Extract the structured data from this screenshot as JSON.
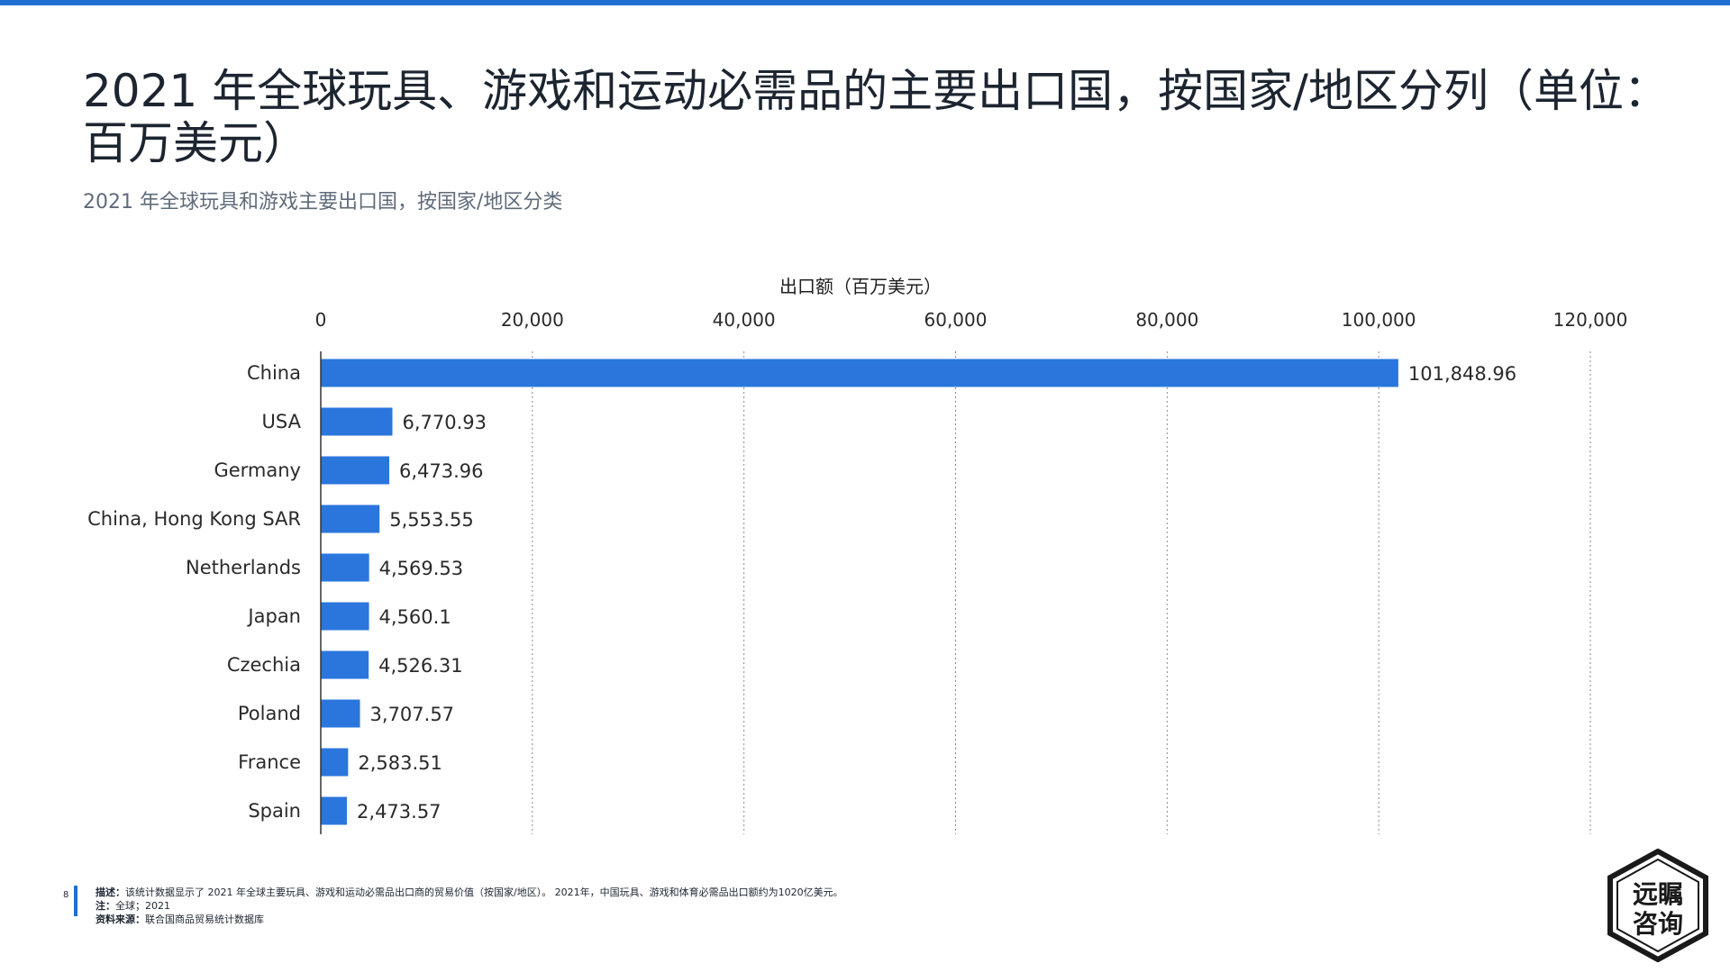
{
  "header": {
    "title": "2021 年全球玩具、游戏和运动必需品的主要出口国，按国家/地区分列（单位：百万美元）",
    "subtitle": "2021 年全球玩具和游戏主要出口国，按国家/地区分类"
  },
  "chart_data": {
    "type": "bar",
    "orientation": "horizontal",
    "xlabel": "出口额（百万美元）",
    "xlim": [
      0,
      120000
    ],
    "ticks": [
      0,
      20000,
      40000,
      60000,
      80000,
      100000,
      120000
    ],
    "tick_labels": [
      "0",
      "20,000",
      "40,000",
      "60,000",
      "80,000",
      "100,000",
      "120,000"
    ],
    "x_axis_position": "top",
    "grid": "vertical-dotted",
    "bar_color": "#2a76dd",
    "categories": [
      "China",
      "USA",
      "Germany",
      "China, Hong Kong SAR",
      "Netherlands",
      "Japan",
      "Czechia",
      "Poland",
      "France",
      "Spain"
    ],
    "values": [
      101848.96,
      6770.93,
      6473.96,
      5553.55,
      4569.53,
      4560.1,
      4526.31,
      3707.57,
      2583.51,
      2473.57
    ],
    "value_labels": [
      "101,848.96",
      "6,770.93",
      "6,473.96",
      "5,553.55",
      "4,569.53",
      "4,560.1",
      "4,526.31",
      "3,707.57",
      "2,583.51",
      "2,473.57"
    ]
  },
  "footer": {
    "page_number": "8",
    "description_label": "描述：",
    "description": "该统计数据显示了 2021 年全球主要玩具、游戏和运动必需品出口商的贸易价值（按国家/地区）。 2021年，中国玩具、游戏和体育必需品出口额约为1020亿美元。",
    "note_label": "注：",
    "note": "全球；2021",
    "source_label": "资料来源：",
    "source": "联合国商品贸易统计数据库"
  },
  "logo": {
    "line1": "远瞩",
    "line2": "咨询"
  }
}
